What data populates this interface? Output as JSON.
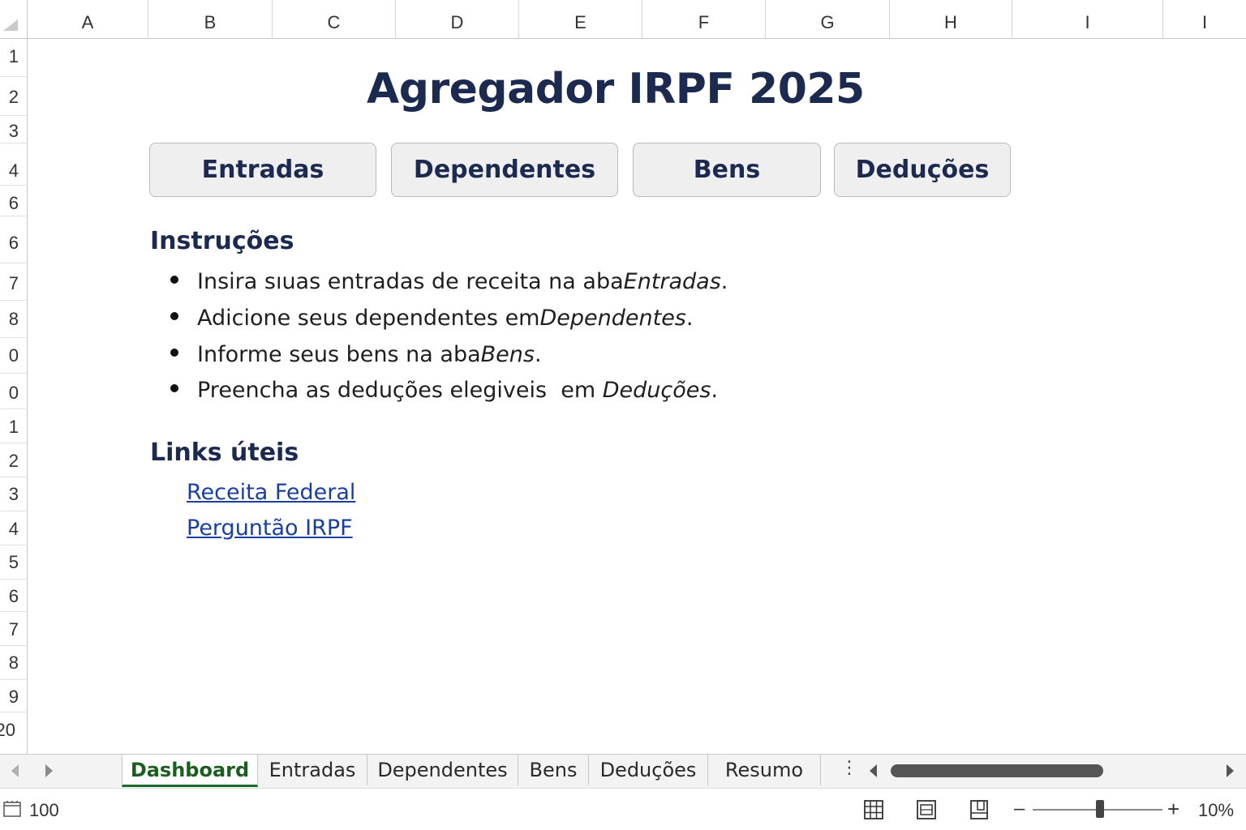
{
  "columns": [
    "A",
    "B",
    "C",
    "D",
    "E",
    "F",
    "G",
    "H",
    "I",
    "I"
  ],
  "rows": [
    "1",
    "2",
    "3",
    "4",
    "6",
    "6",
    "7",
    "8",
    "0",
    "0",
    "1",
    "2",
    "3",
    "4",
    "5",
    "6",
    "7",
    "8",
    "9",
    "20"
  ],
  "sheet": {
    "title": "Agregador IRPF 2025",
    "buttons": {
      "entradas": "Entradas",
      "dependentes": "Dependentes",
      "bens": "Bens",
      "deducoes": "Deduções"
    },
    "instructions": {
      "heading": "Instruções",
      "items": [
        {
          "text": "Insira sıuas entradas de receita na aba ",
          "emph": "Entradas",
          "end": "."
        },
        {
          "text": "Adicione seus dependentes em ",
          "emph": "Dependentes",
          "end": "."
        },
        {
          "text": "Informe seus bens na aba ",
          "emph": "Bens",
          "end": "."
        },
        {
          "text": "Preencha as deduções elegiveis  em ",
          "emph": "Deduções",
          "end": "."
        }
      ]
    },
    "links": {
      "heading": "Links úteis",
      "items": [
        "Receita Federal",
        "Perguntão IRPF"
      ]
    }
  },
  "tabs": {
    "items": [
      "Dashboard",
      "Entradas",
      "Dependentes",
      "Bens",
      "Deduções",
      "Resumo"
    ],
    "active": "Dashboard",
    "more_icon": "⋮"
  },
  "status": {
    "cell_mode_value": "100",
    "zoom_minus": "–",
    "zoom_plus": "+",
    "zoom_level": "10%"
  },
  "icons": {
    "sheet_status": "sheet-status-icon",
    "normal_view": "grid-view-icon",
    "page_layout": "page-layout-icon",
    "page_break": "page-break-icon"
  },
  "colors": {
    "title": "#1b2a4e",
    "link": "#1a3fa0",
    "active_tab": "#1b5e20"
  }
}
